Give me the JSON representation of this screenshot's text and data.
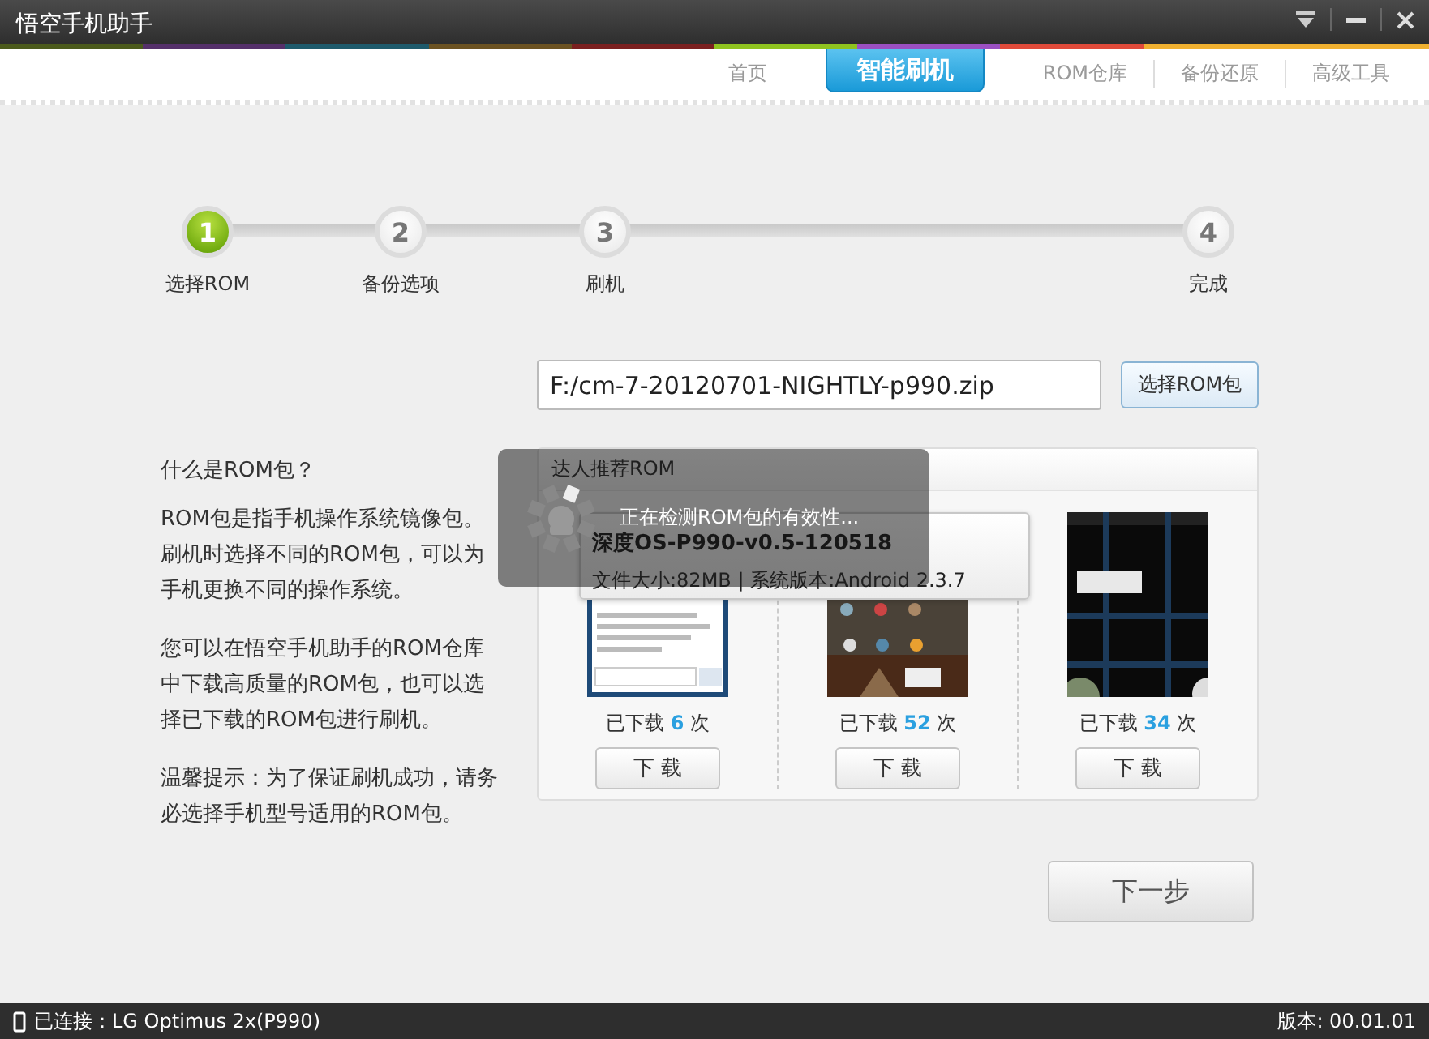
{
  "window": {
    "title": "悟空手机助手"
  },
  "nav_tabs": [
    {
      "label": "首页",
      "selected": false
    },
    {
      "label": "智能刷机",
      "selected": true
    },
    {
      "label": "ROM仓库",
      "selected": false
    },
    {
      "label": "备份还原",
      "selected": false
    },
    {
      "label": "高级工具",
      "selected": false
    }
  ],
  "steps": [
    {
      "number": "1",
      "label": "选择ROM",
      "selected": true
    },
    {
      "number": "2",
      "label": "备份选项",
      "selected": false
    },
    {
      "number": "3",
      "label": "刷机",
      "selected": false
    },
    {
      "number": "4",
      "label": "完成",
      "selected": false
    }
  ],
  "rom_file": {
    "value": "F:/cm-7-20120701-NIGHTLY-p990.zip",
    "button": "选择ROM包"
  },
  "help": {
    "heading": "什么是ROM包？",
    "paragraphs": [
      "ROM包是指手机操作系统镜像包。刷机时选择不同的ROM包，可以为手机更换不同的操作系统。",
      "您可以在悟空手机助手的ROM仓库中下载高质量的ROM包，也可以选择已下载的ROM包进行刷机。",
      "温馨提示：为了保证刷机成功，请务必选择手机型号适用的ROM包。"
    ]
  },
  "recommended": {
    "title": "达人推荐ROM",
    "roms": [
      {
        "downloads": "已下载 **6** 次",
        "button": "下 载"
      },
      {
        "downloads": "已下载 **52** 次",
        "button": "下 载"
      },
      {
        "downloads": "已下载 **34** 次",
        "button": "下 载"
      }
    ]
  },
  "tooltip": {
    "name": "深度OS-P990-v0.5-120518",
    "info": "文件大小:82MB | 系统版本:Android 2.3.7"
  },
  "toast": {
    "message": "正在检测ROM包的有效性..."
  },
  "next_button": "下一步",
  "status_bar": {
    "connection": "已连接：LG Optimus 2x(P990)",
    "version": "版本: 00.01.01"
  }
}
